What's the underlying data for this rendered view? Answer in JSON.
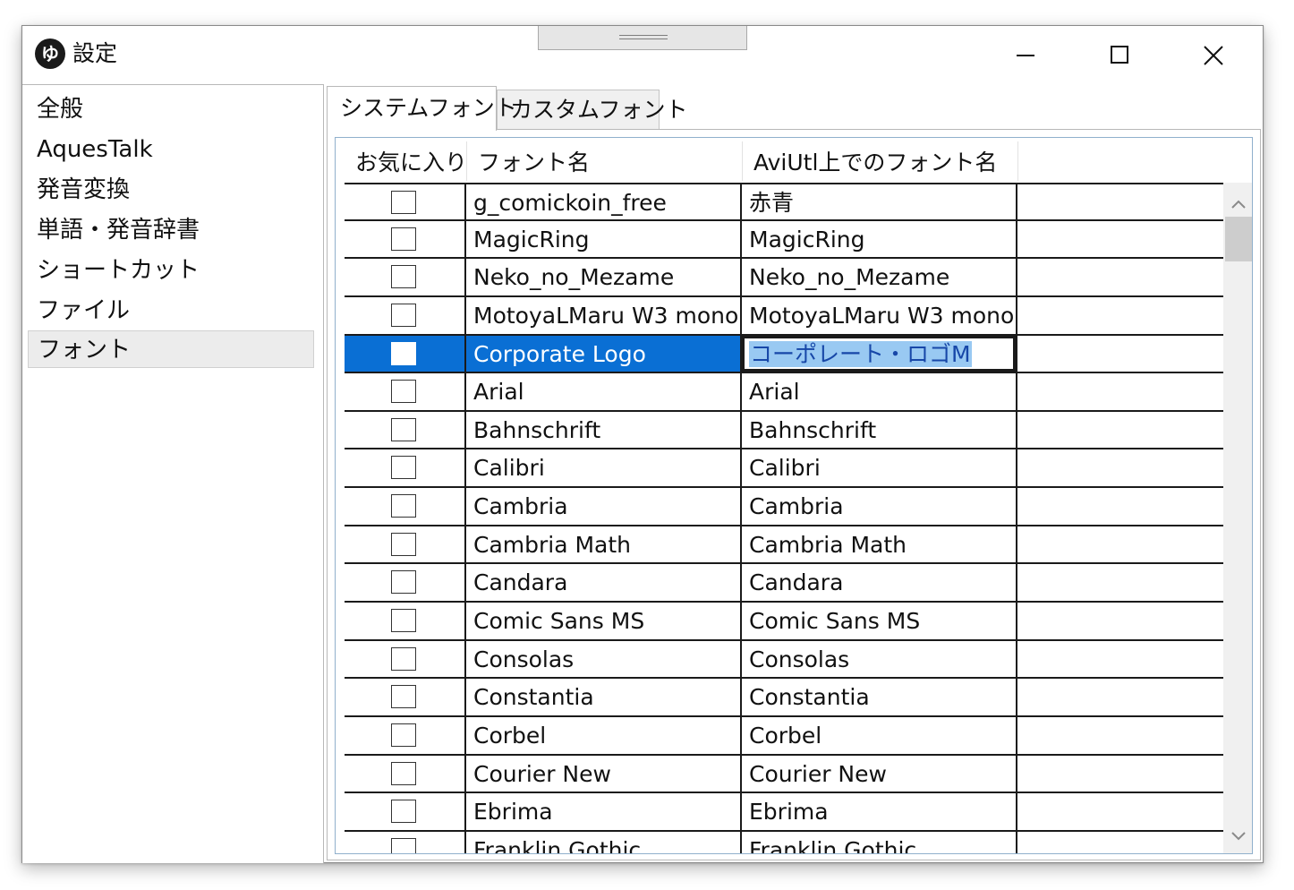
{
  "window": {
    "title": "設定",
    "icon_glyph": "ゆ",
    "controls": {
      "minimize": "minimize-icon",
      "maximize": "maximize-icon",
      "close": "close-icon"
    }
  },
  "sidebar": {
    "items": [
      {
        "label": "全般"
      },
      {
        "label": "AquesTalk"
      },
      {
        "label": "発音変換"
      },
      {
        "label": "単語・発音辞書"
      },
      {
        "label": "ショートカット"
      },
      {
        "label": "ファイル"
      },
      {
        "label": "フォント",
        "selected": true
      }
    ]
  },
  "tabs": [
    {
      "label": "システムフォント",
      "active": true
    },
    {
      "label": "カスタムフォント",
      "active": false
    }
  ],
  "grid": {
    "columns": [
      "お気に入り",
      "フォント名",
      "AviUtl上でのフォント名"
    ],
    "selected_index": 4,
    "rows": [
      {
        "favorite": false,
        "name": "g_comickoin_free",
        "aviutl": "赤青"
      },
      {
        "favorite": false,
        "name": "MagicRing",
        "aviutl": "MagicRing"
      },
      {
        "favorite": false,
        "name": "Neko_no_Mezame",
        "aviutl": "Neko_no_Mezame"
      },
      {
        "favorite": false,
        "name": "MotoyaLMaru W3 mono",
        "aviutl": "MotoyaLMaru W3 mono"
      },
      {
        "favorite": false,
        "name": "Corporate Logo",
        "aviutl": "コーポレート・ロゴM"
      },
      {
        "favorite": false,
        "name": "Arial",
        "aviutl": "Arial"
      },
      {
        "favorite": false,
        "name": "Bahnschrift",
        "aviutl": "Bahnschrift"
      },
      {
        "favorite": false,
        "name": "Calibri",
        "aviutl": "Calibri"
      },
      {
        "favorite": false,
        "name": "Cambria",
        "aviutl": "Cambria"
      },
      {
        "favorite": false,
        "name": "Cambria Math",
        "aviutl": "Cambria Math"
      },
      {
        "favorite": false,
        "name": "Candara",
        "aviutl": "Candara"
      },
      {
        "favorite": false,
        "name": "Comic Sans MS",
        "aviutl": "Comic Sans MS"
      },
      {
        "favorite": false,
        "name": "Consolas",
        "aviutl": "Consolas"
      },
      {
        "favorite": false,
        "name": "Constantia",
        "aviutl": "Constantia"
      },
      {
        "favorite": false,
        "name": "Corbel",
        "aviutl": "Corbel"
      },
      {
        "favorite": false,
        "name": "Courier New",
        "aviutl": "Courier New"
      },
      {
        "favorite": false,
        "name": "Ebrima",
        "aviutl": "Ebrima"
      },
      {
        "favorite": false,
        "name": "Franklin Gothic",
        "aviutl": "Franklin Gothic"
      }
    ]
  },
  "scrollbar": {
    "up": "chevron-up-icon",
    "down": "chevron-down-icon"
  },
  "colors": {
    "selection": "#0a6fd4",
    "edit_highlight": "#99c9f2",
    "grid_lines": "#1a1a1a"
  }
}
